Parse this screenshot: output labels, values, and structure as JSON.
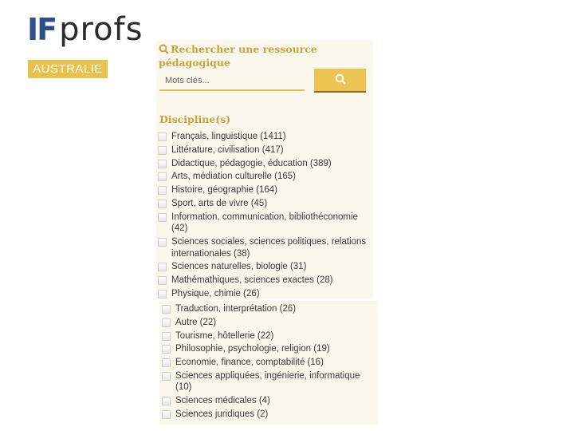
{
  "brand": {
    "logo_i": "I",
    "logo_f": "F",
    "logo_rest": "profs",
    "badge": "AUSTRALIE",
    "colors": {
      "blue": "#2f4f8a",
      "gold": "#e8c24a",
      "gold_text": "#c9a23a"
    }
  },
  "search": {
    "title": "Rechercher une ressource pédagogique",
    "placeholder": "Mots clés...",
    "button_icon": "search-icon"
  },
  "disciplines": {
    "title": "Discipline(s)",
    "items_panel1": [
      "Français, linguistique (1411)",
      "Littérature, civilisation (417)",
      "Didactique, pédagogie, éducation (389)",
      "Arts, médiation culturelle (165)",
      "Histoire, géographie (164)",
      "Sport, arts de vivre (45)",
      "Information, communication, bibliothéconomie (42)",
      "Sciences sociales, sciences politiques, relations internationales (38)",
      "Sciences naturelles, biologie (31)",
      "Mathémathiques, sciences exactes (28)",
      "Physique, chimie (26)"
    ],
    "items_panel2": [
      "Traduction, interprétation (26)",
      "Autre (22)",
      "Tourisme, hôtellerie (22)",
      "Philosophie, psychologie, religion (19)",
      "Economie, finance, comptabilité (16)",
      "Sciences appliquées, ingénierie, informatique (10)",
      "Sciences médicales (4)",
      "Sciences juridiques (2)"
    ]
  }
}
